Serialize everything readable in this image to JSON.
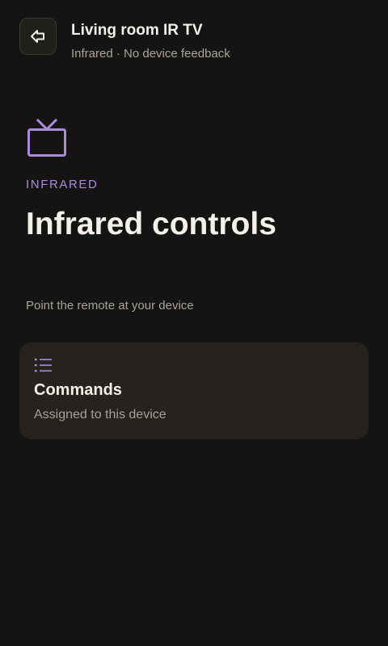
{
  "header": {
    "back_icon": "back-arrow-icon",
    "title": "Living room IR TV",
    "subtitle": "Infrared · No device feedback"
  },
  "hero": {
    "icon": "tv-icon",
    "eyebrow": "INFRARED",
    "title": "Infrared controls",
    "hint": "Point the remote at your device"
  },
  "commands_card": {
    "icon": "list-icon",
    "title": "Commands",
    "subtitle": "Assigned to this device"
  },
  "colors": {
    "background": "#151412",
    "card": "#26221e",
    "accent": "#a98ce0",
    "text_primary": "#f2efe9",
    "text_secondary": "#a7a29a"
  }
}
